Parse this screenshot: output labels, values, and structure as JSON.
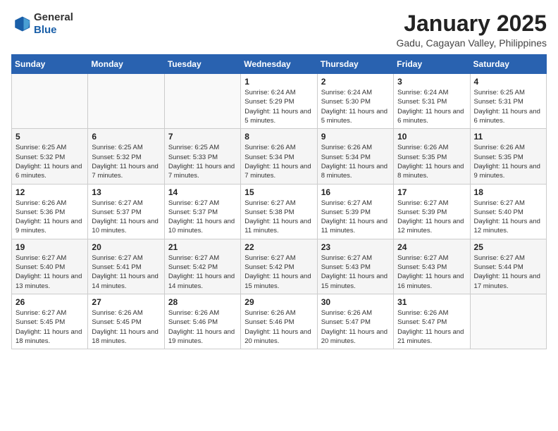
{
  "logo": {
    "line1": "General",
    "line2": "Blue"
  },
  "title": "January 2025",
  "subtitle": "Gadu, Cagayan Valley, Philippines",
  "days_of_week": [
    "Sunday",
    "Monday",
    "Tuesday",
    "Wednesday",
    "Thursday",
    "Friday",
    "Saturday"
  ],
  "weeks": [
    [
      {
        "day": "",
        "info": ""
      },
      {
        "day": "",
        "info": ""
      },
      {
        "day": "",
        "info": ""
      },
      {
        "day": "1",
        "info": "Sunrise: 6:24 AM\nSunset: 5:29 PM\nDaylight: 11 hours\nand 5 minutes."
      },
      {
        "day": "2",
        "info": "Sunrise: 6:24 AM\nSunset: 5:30 PM\nDaylight: 11 hours\nand 5 minutes."
      },
      {
        "day": "3",
        "info": "Sunrise: 6:24 AM\nSunset: 5:31 PM\nDaylight: 11 hours\nand 6 minutes."
      },
      {
        "day": "4",
        "info": "Sunrise: 6:25 AM\nSunset: 5:31 PM\nDaylight: 11 hours\nand 6 minutes."
      }
    ],
    [
      {
        "day": "5",
        "info": "Sunrise: 6:25 AM\nSunset: 5:32 PM\nDaylight: 11 hours\nand 6 minutes."
      },
      {
        "day": "6",
        "info": "Sunrise: 6:25 AM\nSunset: 5:32 PM\nDaylight: 11 hours\nand 7 minutes."
      },
      {
        "day": "7",
        "info": "Sunrise: 6:25 AM\nSunset: 5:33 PM\nDaylight: 11 hours\nand 7 minutes."
      },
      {
        "day": "8",
        "info": "Sunrise: 6:26 AM\nSunset: 5:34 PM\nDaylight: 11 hours\nand 7 minutes."
      },
      {
        "day": "9",
        "info": "Sunrise: 6:26 AM\nSunset: 5:34 PM\nDaylight: 11 hours\nand 8 minutes."
      },
      {
        "day": "10",
        "info": "Sunrise: 6:26 AM\nSunset: 5:35 PM\nDaylight: 11 hours\nand 8 minutes."
      },
      {
        "day": "11",
        "info": "Sunrise: 6:26 AM\nSunset: 5:35 PM\nDaylight: 11 hours\nand 9 minutes."
      }
    ],
    [
      {
        "day": "12",
        "info": "Sunrise: 6:26 AM\nSunset: 5:36 PM\nDaylight: 11 hours\nand 9 minutes."
      },
      {
        "day": "13",
        "info": "Sunrise: 6:27 AM\nSunset: 5:37 PM\nDaylight: 11 hours\nand 10 minutes."
      },
      {
        "day": "14",
        "info": "Sunrise: 6:27 AM\nSunset: 5:37 PM\nDaylight: 11 hours\nand 10 minutes."
      },
      {
        "day": "15",
        "info": "Sunrise: 6:27 AM\nSunset: 5:38 PM\nDaylight: 11 hours\nand 11 minutes."
      },
      {
        "day": "16",
        "info": "Sunrise: 6:27 AM\nSunset: 5:39 PM\nDaylight: 11 hours\nand 11 minutes."
      },
      {
        "day": "17",
        "info": "Sunrise: 6:27 AM\nSunset: 5:39 PM\nDaylight: 11 hours\nand 12 minutes."
      },
      {
        "day": "18",
        "info": "Sunrise: 6:27 AM\nSunset: 5:40 PM\nDaylight: 11 hours\nand 12 minutes."
      }
    ],
    [
      {
        "day": "19",
        "info": "Sunrise: 6:27 AM\nSunset: 5:40 PM\nDaylight: 11 hours\nand 13 minutes."
      },
      {
        "day": "20",
        "info": "Sunrise: 6:27 AM\nSunset: 5:41 PM\nDaylight: 11 hours\nand 14 minutes."
      },
      {
        "day": "21",
        "info": "Sunrise: 6:27 AM\nSunset: 5:42 PM\nDaylight: 11 hours\nand 14 minutes."
      },
      {
        "day": "22",
        "info": "Sunrise: 6:27 AM\nSunset: 5:42 PM\nDaylight: 11 hours\nand 15 minutes."
      },
      {
        "day": "23",
        "info": "Sunrise: 6:27 AM\nSunset: 5:43 PM\nDaylight: 11 hours\nand 15 minutes."
      },
      {
        "day": "24",
        "info": "Sunrise: 6:27 AM\nSunset: 5:43 PM\nDaylight: 11 hours\nand 16 minutes."
      },
      {
        "day": "25",
        "info": "Sunrise: 6:27 AM\nSunset: 5:44 PM\nDaylight: 11 hours\nand 17 minutes."
      }
    ],
    [
      {
        "day": "26",
        "info": "Sunrise: 6:27 AM\nSunset: 5:45 PM\nDaylight: 11 hours\nand 18 minutes."
      },
      {
        "day": "27",
        "info": "Sunrise: 6:26 AM\nSunset: 5:45 PM\nDaylight: 11 hours\nand 18 minutes."
      },
      {
        "day": "28",
        "info": "Sunrise: 6:26 AM\nSunset: 5:46 PM\nDaylight: 11 hours\nand 19 minutes."
      },
      {
        "day": "29",
        "info": "Sunrise: 6:26 AM\nSunset: 5:46 PM\nDaylight: 11 hours\nand 20 minutes."
      },
      {
        "day": "30",
        "info": "Sunrise: 6:26 AM\nSunset: 5:47 PM\nDaylight: 11 hours\nand 20 minutes."
      },
      {
        "day": "31",
        "info": "Sunrise: 6:26 AM\nSunset: 5:47 PM\nDaylight: 11 hours\nand 21 minutes."
      },
      {
        "day": "",
        "info": ""
      }
    ]
  ]
}
